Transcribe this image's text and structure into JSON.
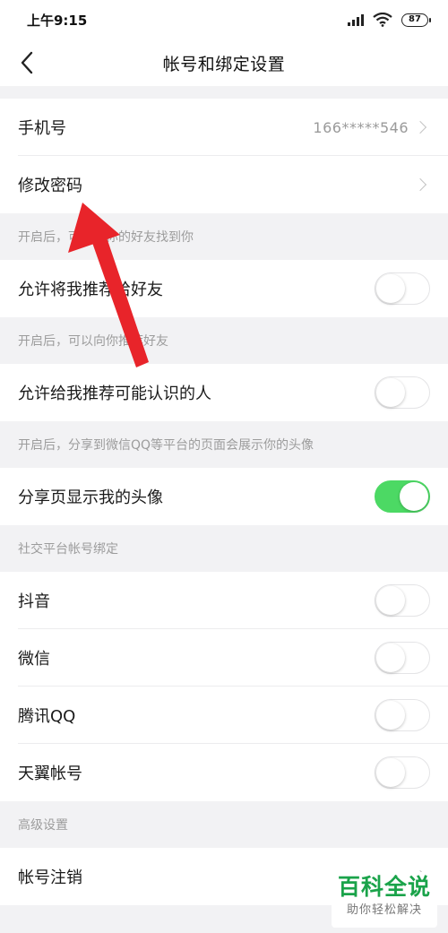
{
  "status_bar": {
    "time": "上午9:15",
    "battery": "87"
  },
  "header": {
    "title": "帐号和绑定设置"
  },
  "account": {
    "phone_label": "手机号",
    "phone_value": "166*****546",
    "password_label": "修改密码"
  },
  "sections": {
    "friends_hint": "开启后，可以让你的好友找到你",
    "recommend_to_friends_label": "允许将我推荐给好友",
    "recommend_to_friends_on": false,
    "recommend_hint": "开启后，可以向你推荐好友",
    "recommend_known_label": "允许给我推荐可能认识的人",
    "recommend_known_on": false,
    "avatar_hint": "开启后，分享到微信QQ等平台的页面会展示你的头像",
    "avatar_label": "分享页显示我的头像",
    "avatar_on": true,
    "social_header": "社交平台帐号绑定",
    "douyin_label": "抖音",
    "wechat_label": "微信",
    "qq_label": "腾讯QQ",
    "tianyi_label": "天翼帐号",
    "advanced_header": "高级设置",
    "cancel_account_label": "帐号注销"
  },
  "watermark": {
    "main": "百科全说",
    "sub": "助你轻松解决"
  },
  "colors": {
    "toggle_on": "#4cd964",
    "annotation_arrow": "#e8242a",
    "watermark_green": "#1aa34a"
  }
}
